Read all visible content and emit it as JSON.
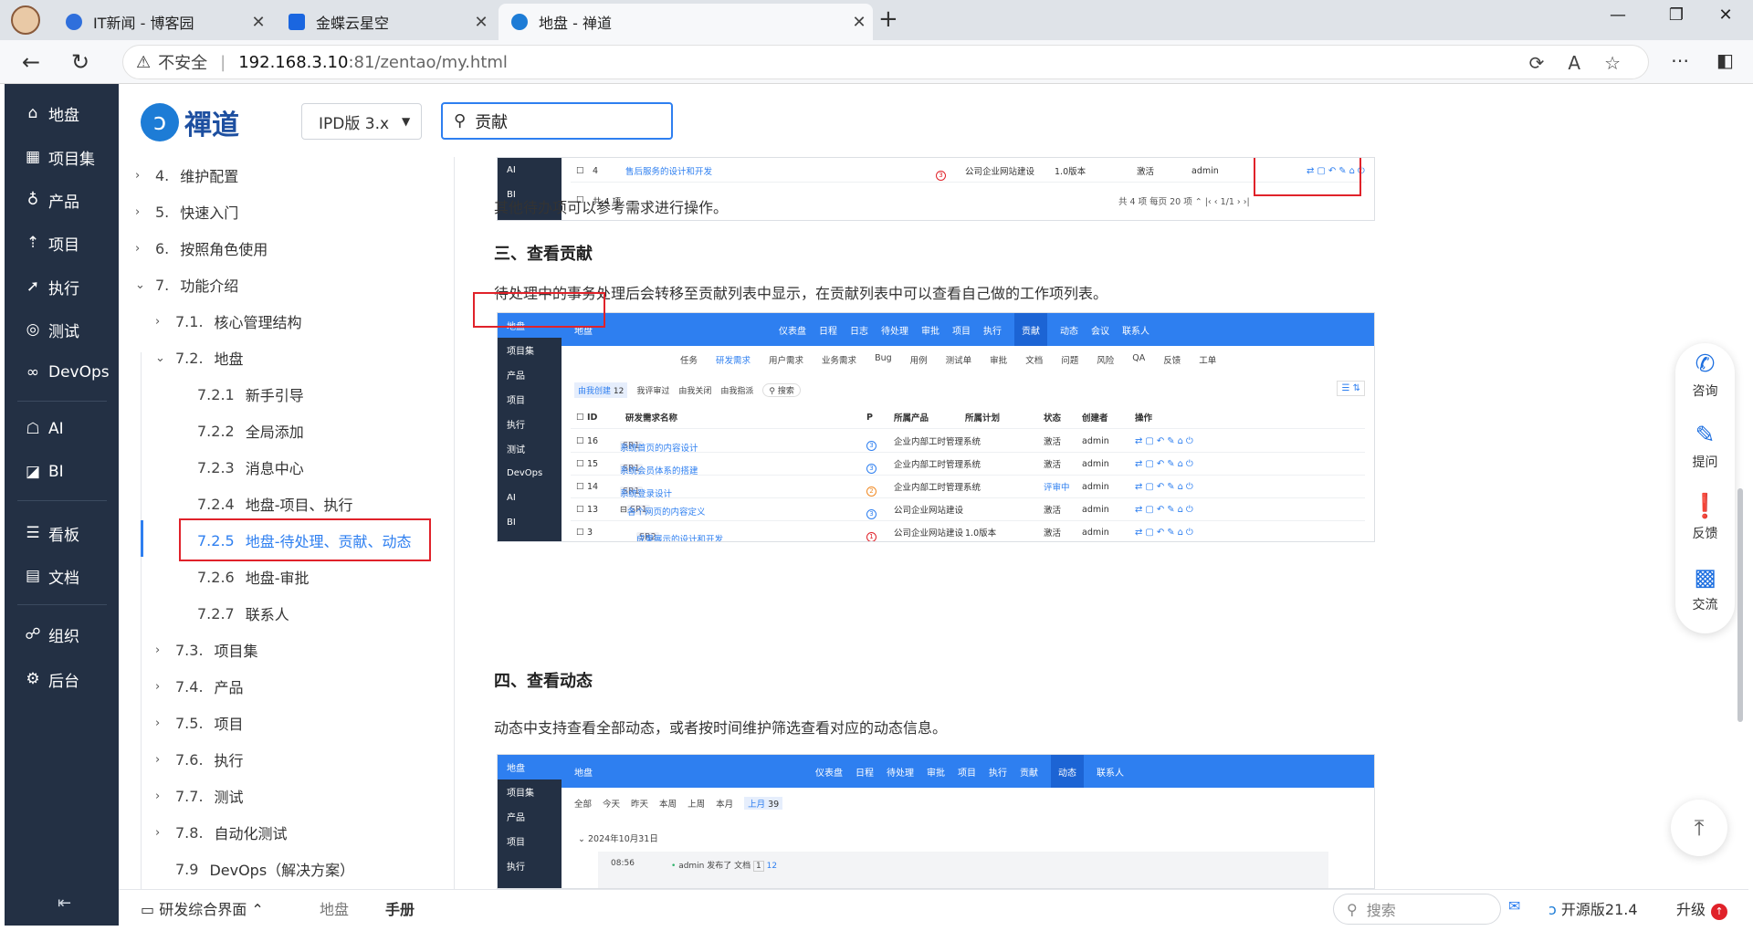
{
  "browser": {
    "tabs": [
      {
        "title": "IT新闻 - 博客园",
        "color": "#2f6fdc"
      },
      {
        "title": "金蝶云星空",
        "color": "#1a66e0"
      },
      {
        "title": "地盘 - 禅道",
        "color": "#1d7cd6"
      }
    ],
    "url": {
      "warning": "不安全",
      "host": "192.168.3.10",
      "path": ":81/zentao/my.html"
    }
  },
  "nav": {
    "items": [
      {
        "icon": "home-icon",
        "glyph": "⌂",
        "label": "地盘"
      },
      {
        "icon": "grid-icon",
        "glyph": "▦",
        "label": "项目集"
      },
      {
        "icon": "bulb-icon",
        "glyph": "♁",
        "label": "产品"
      },
      {
        "icon": "rocket-icon",
        "glyph": "⇡",
        "label": "项目"
      },
      {
        "icon": "run-icon",
        "glyph": "➚",
        "label": "执行"
      },
      {
        "icon": "test-icon",
        "glyph": "◎",
        "label": "测试"
      },
      {
        "icon": "infinity-icon",
        "glyph": "∞",
        "label": "DevOps"
      },
      {
        "icon": "robot-icon",
        "glyph": "☖",
        "label": "AI"
      },
      {
        "icon": "chart-icon",
        "glyph": "◪",
        "label": "BI"
      },
      {
        "icon": "kanban-icon",
        "glyph": "☰",
        "label": "看板"
      },
      {
        "icon": "doc-icon",
        "glyph": "▤",
        "label": "文档"
      },
      {
        "icon": "org-icon",
        "glyph": "☍",
        "label": "组织"
      },
      {
        "icon": "gear-icon",
        "glyph": "⚙",
        "label": "后台"
      }
    ]
  },
  "header": {
    "logo": "禪道",
    "version": "IPD版 3.x",
    "search_value": "贡献"
  },
  "toc": [
    {
      "num": "4.",
      "label": "维护配置",
      "level": 1,
      "chev": "›"
    },
    {
      "num": "5.",
      "label": "快速入门",
      "level": 1,
      "chev": "›"
    },
    {
      "num": "6.",
      "label": "按照角色使用",
      "level": 1,
      "chev": "›"
    },
    {
      "num": "7.",
      "label": "功能介绍",
      "level": 1,
      "chev": "⌄"
    },
    {
      "num": "7.1.",
      "label": "核心管理结构",
      "level": 2,
      "chev": "›"
    },
    {
      "num": "7.2.",
      "label": "地盘",
      "level": 2,
      "chev": "⌄"
    },
    {
      "num": "7.2.1",
      "label": "新手引导",
      "level": 3,
      "chev": ""
    },
    {
      "num": "7.2.2",
      "label": "全局添加",
      "level": 3,
      "chev": ""
    },
    {
      "num": "7.2.3",
      "label": "消息中心",
      "level": 3,
      "chev": ""
    },
    {
      "num": "7.2.4",
      "label": "地盘-项目、执行",
      "level": 3,
      "chev": ""
    },
    {
      "num": "7.2.5",
      "label": "地盘-待处理、贡献、动态",
      "level": 3,
      "chev": "",
      "selected": true
    },
    {
      "num": "7.2.6",
      "label": "地盘-审批",
      "level": 3,
      "chev": ""
    },
    {
      "num": "7.2.7",
      "label": "联系人",
      "level": 3,
      "chev": ""
    },
    {
      "num": "7.3.",
      "label": "项目集",
      "level": 2,
      "chev": "›"
    },
    {
      "num": "7.4.",
      "label": "产品",
      "level": 2,
      "chev": "›"
    },
    {
      "num": "7.5.",
      "label": "项目",
      "level": 2,
      "chev": "›"
    },
    {
      "num": "7.6.",
      "label": "执行",
      "level": 2,
      "chev": "›"
    },
    {
      "num": "7.7.",
      "label": "测试",
      "level": 2,
      "chev": "›"
    },
    {
      "num": "7.8.",
      "label": "自动化测试",
      "level": 2,
      "chev": "›"
    },
    {
      "num": "7.9",
      "label": "DevOps（解决方案）",
      "level": 2,
      "chev": ""
    }
  ],
  "content": {
    "p1": "其他待办项可以参考需求进行操作。",
    "h_contrib": "三、查看贡献",
    "p2": "待处理中的事务处理后会转移至贡献列表中显示，在贡献列表中可以查看自己做的工作项列表。",
    "h_dynamic": "四、查看动态",
    "p3": "动态中支持查看全部动态，或者按时间维护筛选查看对应的动态信息。"
  },
  "shot1": {
    "side": [
      "AI",
      "BI"
    ],
    "rows": [
      {
        "id": "4",
        "name": "售后服务的设计和开发",
        "pri": "3",
        "prod": "公司企业网站建设",
        "plan": "1.0版本",
        "status": "激活",
        "creator": "admin"
      }
    ],
    "footer_left": "共 4 项",
    "footer_right": "共 4 项  每页 20 项  ⌃  |‹  ‹  1/1  ›  ›|"
  },
  "shot2": {
    "side": [
      "地盘",
      "项目集",
      "产品",
      "项目",
      "执行",
      "测试",
      "DevOps",
      "AI",
      "BI"
    ],
    "title": "地盘",
    "menu": [
      "仪表盘",
      "日程",
      "日志",
      "待处理",
      "审批",
      "项目",
      "执行",
      "贡献",
      "动态",
      "会议",
      "联系人"
    ],
    "menu_active": "贡献",
    "subtabs": [
      "任务",
      "研发需求",
      "用户需求",
      "业务需求",
      "Bug",
      "用例",
      "测试单",
      "审批",
      "文档",
      "问题",
      "风险",
      "QA",
      "反馈",
      "工单"
    ],
    "filters": [
      "由我创建",
      "12",
      "我评审过",
      "由我关闭",
      "由我指派",
      "搜索"
    ],
    "cols": [
      "ID",
      "研发需求名称",
      "P",
      "所属产品",
      "所属计划",
      "状态",
      "创建者",
      "操作"
    ],
    "rows": [
      {
        "id": "16",
        "tag": "SR1",
        "name": "系统首页的内容设计",
        "pri": "3",
        "prod": "企业内部工时管理系统",
        "plan": "",
        "status": "激活",
        "creator": "admin"
      },
      {
        "id": "15",
        "tag": "SR1",
        "name": "系统会员体系的搭建",
        "pri": "3",
        "prod": "企业内部工时管理系统",
        "plan": "",
        "status": "激活",
        "creator": "admin"
      },
      {
        "id": "14",
        "tag": "SR1",
        "name": "系统登录设计",
        "pri": "2",
        "prod": "企业内部工时管理系统",
        "plan": "",
        "status": "评审中",
        "creator": "admin"
      },
      {
        "id": "13",
        "tag": "SR1",
        "name": "各个网页的内容定义",
        "pri": "3",
        "prod": "公司企业网站建设",
        "plan": "",
        "status": "激活",
        "creator": "admin"
      },
      {
        "id": "3",
        "tag": "SR2",
        "name": "成果展示的设计和开发",
        "pri": "1",
        "prod": "公司企业网站建设",
        "plan": "1.0版本",
        "status": "激活",
        "creator": "admin"
      }
    ]
  },
  "shot3": {
    "side": [
      "地盘",
      "项目集",
      "产品",
      "项目",
      "执行"
    ],
    "title": "地盘",
    "menu": [
      "仪表盘",
      "日程",
      "待处理",
      "审批",
      "项目",
      "执行",
      "贡献",
      "动态",
      "联系人"
    ],
    "menu_active": "动态",
    "filters": [
      "全部",
      "今天",
      "昨天",
      "本周",
      "上周",
      "本月",
      "上月",
      "39"
    ],
    "date": "2024年10月31日",
    "entry": {
      "time": "08:56",
      "text": "admin 发布了 文档",
      "idx": "1",
      "num": "12"
    }
  },
  "float": [
    "咨询",
    "提问",
    "反馈",
    "交流"
  ],
  "bottom": {
    "workspace": "研发综合界面",
    "crumb1": "地盘",
    "crumb2": "手册",
    "search": "搜索",
    "edition": "开源版21.4",
    "upgrade": "升级",
    "badge": "↑"
  }
}
